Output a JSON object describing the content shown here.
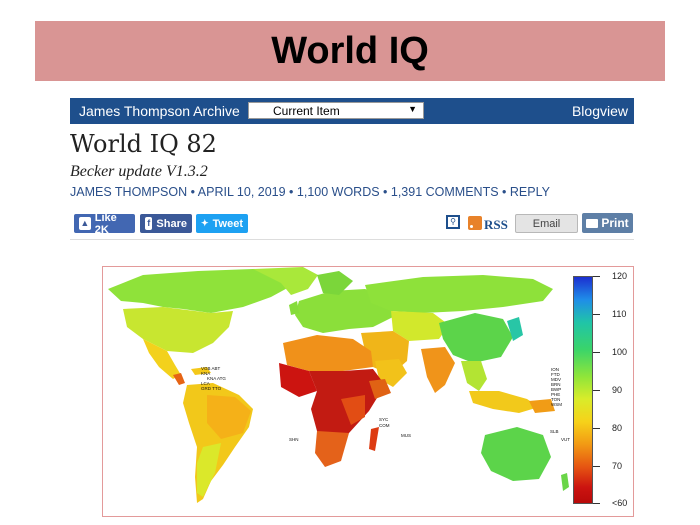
{
  "slide": {
    "title": "World IQ"
  },
  "nav": {
    "brand": "James Thompson Archive",
    "select_value": "Current Item",
    "blogview": "Blogview"
  },
  "article": {
    "title": "World IQ 82",
    "subtitle": "Becker update V1.3.2",
    "meta": "JAMES THOMPSON • APRIL 10, 2019 • 1,100 WORDS • 1,391 COMMENTS • REPLY"
  },
  "share": {
    "like": "Like 2K",
    "share": "Share",
    "tweet": "Tweet",
    "rss": "RSS",
    "email": "Email",
    "print": "Print"
  },
  "map": {
    "legend_ticks": [
      "120",
      "110",
      "100",
      "90",
      "80",
      "70",
      "<60"
    ],
    "caribbean_labels": [
      "VGB ABT",
      "KNA",
      "KNA ATG",
      "LCA",
      "GRD TTO"
    ],
    "africa_labels": [
      "SHN",
      "SYC",
      "COM",
      "MUS"
    ],
    "asia_labels": [
      "ION",
      "FTD",
      "MDV",
      "BRN",
      "BWP",
      "PHE",
      "TON",
      "WSM"
    ],
    "pacific_labels": [
      "SLB",
      "VUT"
    ]
  },
  "colors": {
    "title_bar": "#d99594",
    "nav_bar": "#1e4f8c",
    "link": "#2a4f8a"
  }
}
